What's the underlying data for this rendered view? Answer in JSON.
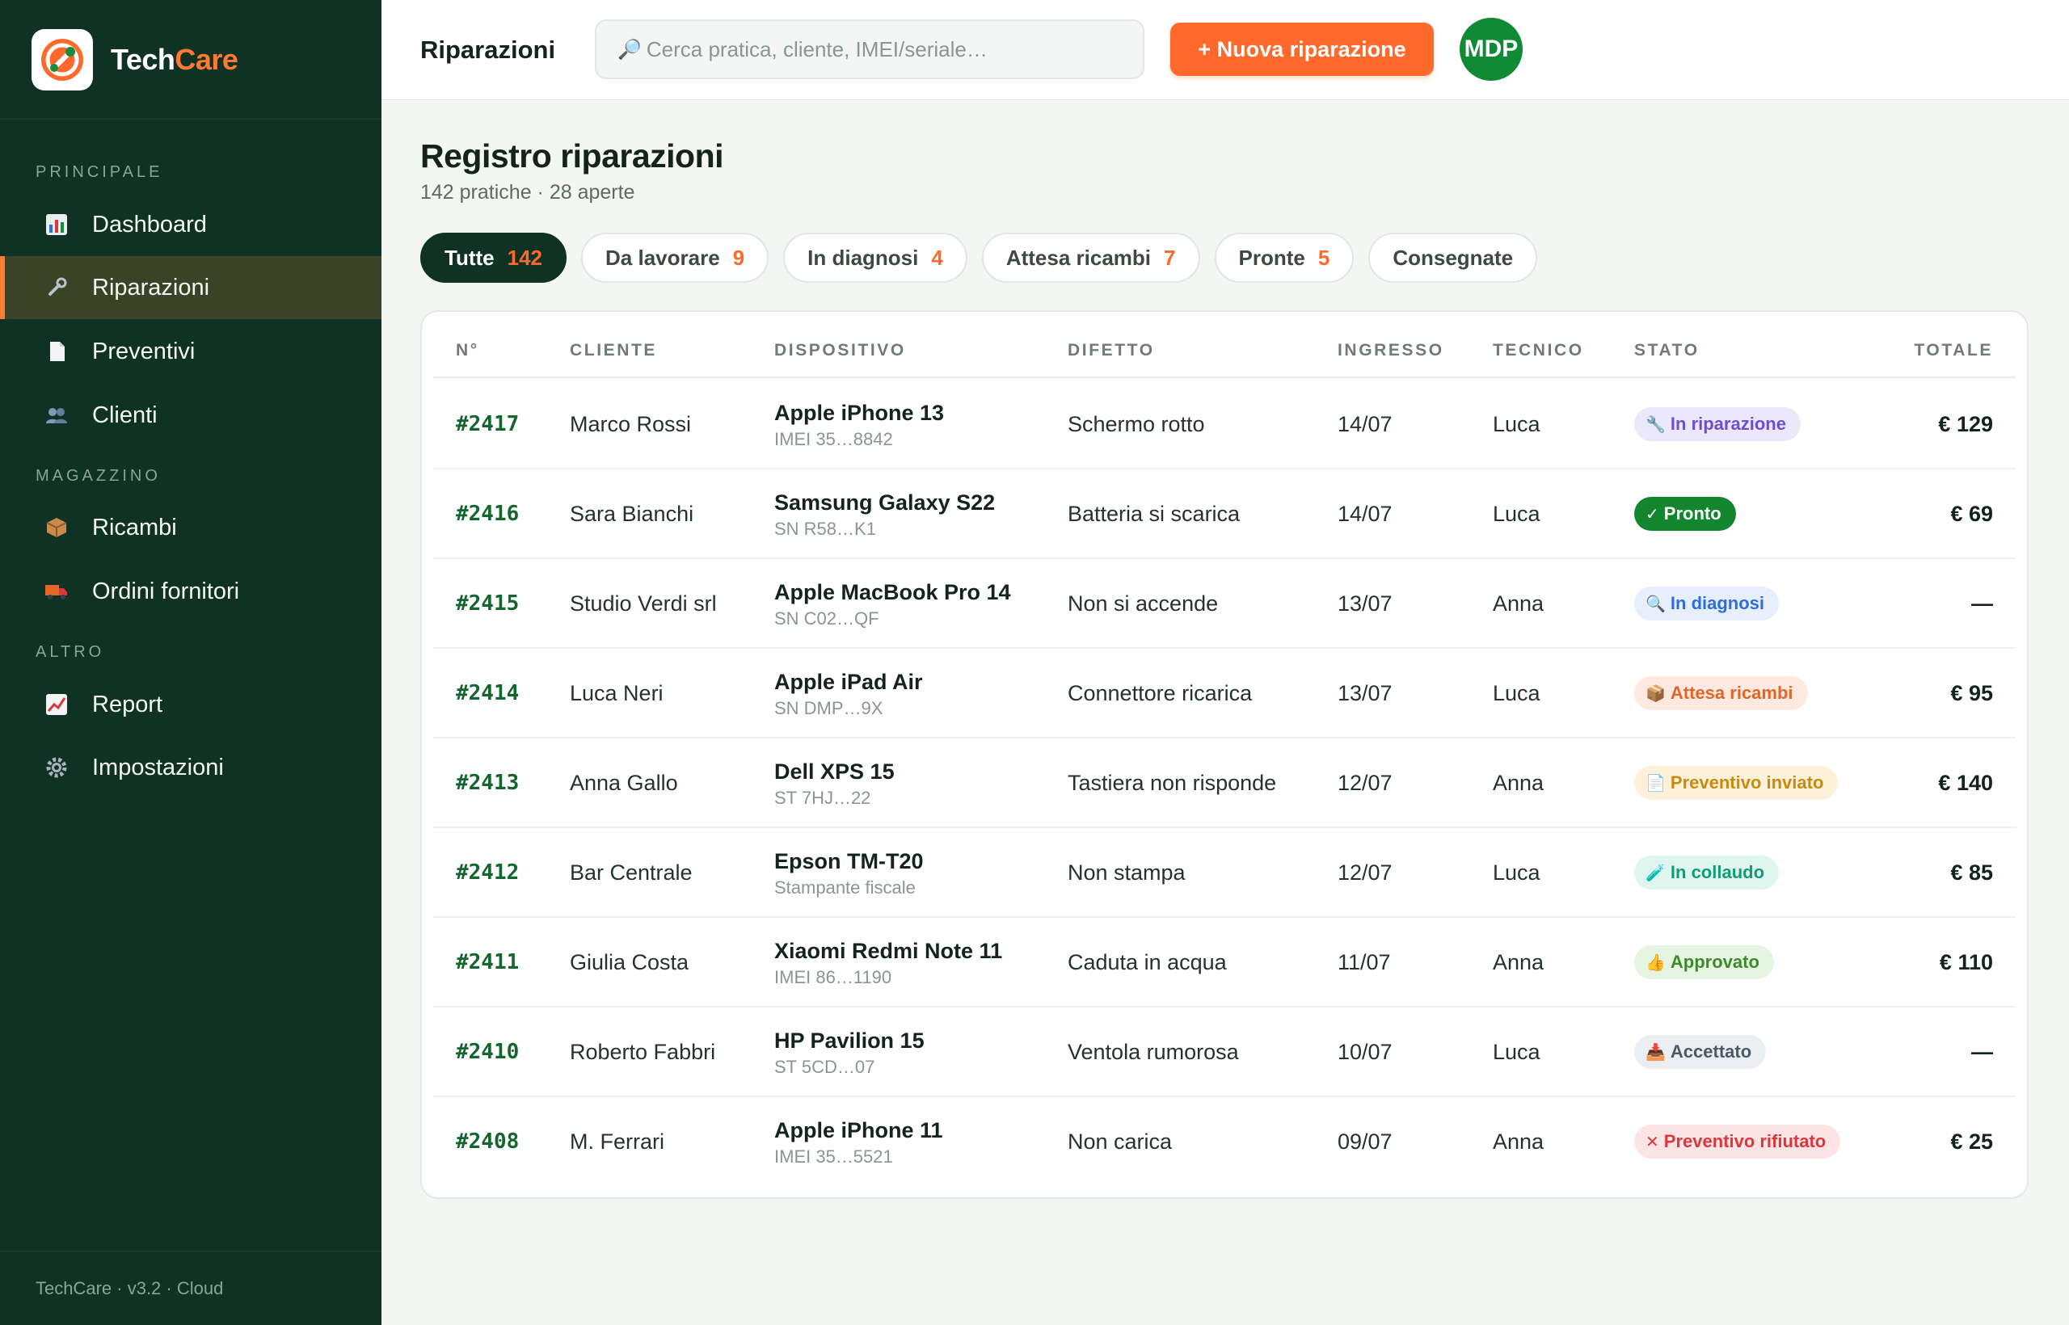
{
  "brand": {
    "name_part1": "Tech",
    "name_part2": "Care"
  },
  "sidebar": {
    "sections": [
      "PRINCIPALE",
      "MAGAZZINO",
      "ALTRO"
    ],
    "items": [
      {
        "label": "Dashboard",
        "icon": "chart-icon"
      },
      {
        "label": "Riparazioni",
        "icon": "wrench-icon"
      },
      {
        "label": "Preventivi",
        "icon": "document-icon"
      },
      {
        "label": "Clienti",
        "icon": "users-icon"
      },
      {
        "label": "Ricambi",
        "icon": "package-icon"
      },
      {
        "label": "Ordini fornitori",
        "icon": "truck-icon"
      },
      {
        "label": "Report",
        "icon": "trend-icon"
      },
      {
        "label": "Impostazioni",
        "icon": "gear-icon"
      }
    ],
    "active_item": "Riparazioni",
    "footer": "TechCare · v3.2 · Cloud"
  },
  "topbar": {
    "title": "Riparazioni",
    "search_placeholder": "Cerca pratica, cliente, IMEI/seriale…",
    "new_button": "+ Nuova riparazione",
    "avatar_initials": "MDP"
  },
  "main": {
    "title": "Registro riparazioni",
    "subtitle": "142 pratiche · 28 aperte",
    "filters": [
      {
        "label": "Tutte",
        "count": "142"
      },
      {
        "label": "Da lavorare",
        "count": "9"
      },
      {
        "label": "In diagnosi",
        "count": "4"
      },
      {
        "label": "Attesa ricambi",
        "count": "7"
      },
      {
        "label": "Pronte",
        "count": "5"
      },
      {
        "label": "Consegnate",
        "count": ""
      }
    ],
    "active_filter": "Tutte"
  },
  "table": {
    "headers": [
      "N°",
      "CLIENTE",
      "DISPOSITIVO",
      "DIFETTO",
      "INGRESSO",
      "TECNICO",
      "STATO",
      "TOTALE"
    ],
    "rows": [
      {
        "num": "#2417",
        "client": "Marco Rossi",
        "device": "Apple iPhone 13",
        "device_sub": "IMEI 35…8842",
        "defect": "Schermo rotto",
        "date": "14/07",
        "tech": "Luca",
        "status": "In riparazione",
        "status_icon": "🔧",
        "total": "€ 129"
      },
      {
        "num": "#2416",
        "client": "Sara Bianchi",
        "device": "Samsung Galaxy S22",
        "device_sub": "SN R58…K1",
        "defect": "Batteria si scarica",
        "date": "14/07",
        "tech": "Luca",
        "status": "Pronto",
        "status_icon": "✓",
        "total": "€ 69"
      },
      {
        "num": "#2415",
        "client": "Studio Verdi srl",
        "device": "Apple MacBook Pro 14",
        "device_sub": "SN C02…QF",
        "defect": "Non si accende",
        "date": "13/07",
        "tech": "Anna",
        "status": "In diagnosi",
        "status_icon": "🔍",
        "total": "—"
      },
      {
        "num": "#2414",
        "client": "Luca Neri",
        "device": "Apple iPad Air",
        "device_sub": "SN DMP…9X",
        "defect": "Connettore ricarica",
        "date": "13/07",
        "tech": "Luca",
        "status": "Attesa ricambi",
        "status_icon": "📦",
        "total": "€ 95"
      },
      {
        "num": "#2413",
        "client": "Anna Gallo",
        "device": "Dell XPS 15",
        "device_sub": "ST 7HJ…22",
        "defect": "Tastiera non risponde",
        "date": "12/07",
        "tech": "Anna",
        "status": "Preventivo inviato",
        "status_icon": "📄",
        "total": "€ 140"
      },
      {
        "num": "#2412",
        "client": "Bar Centrale",
        "device": "Epson TM-T20",
        "device_sub": "Stampante fiscale",
        "defect": "Non stampa",
        "date": "12/07",
        "tech": "Luca",
        "status": "In collaudo",
        "status_icon": "🧪",
        "total": "€ 85"
      },
      {
        "num": "#2411",
        "client": "Giulia Costa",
        "device": "Xiaomi Redmi Note 11",
        "device_sub": "IMEI 86…1190",
        "defect": "Caduta in acqua",
        "date": "11/07",
        "tech": "Anna",
        "status": "Approvato",
        "status_icon": "👍",
        "total": "€ 110"
      },
      {
        "num": "#2410",
        "client": "Roberto Fabbri",
        "device": "HP Pavilion 15",
        "device_sub": "ST 5CD…07",
        "defect": "Ventola rumorosa",
        "date": "10/07",
        "tech": "Luca",
        "status": "Accettato",
        "status_icon": "📥",
        "total": "—"
      },
      {
        "num": "#2408",
        "client": "M. Ferrari",
        "device": "Apple iPhone 11",
        "device_sub": "IMEI 35…5521",
        "defect": "Non carica",
        "date": "09/07",
        "tech": "Anna",
        "status": "Preventivo rifiutato",
        "status_icon": "✕",
        "total": "€ 25"
      }
    ]
  },
  "colors": {
    "sidebar_bg": "#0f3224",
    "accent": "#ff6a2c",
    "status_in_riparazione": "#6b4fd0",
    "status_pronto": "#13852f",
    "status_in_diagnosi": "#2f6ddb",
    "status_attesa_ricambi": "#e0662a",
    "status_preventivo_inviato": "#c98a12",
    "status_in_collaudo": "#139b78",
    "status_approvato": "#3e8a2a",
    "status_accettato": "#4a5a66",
    "status_preventivo_rifiutato": "#d9383c"
  }
}
